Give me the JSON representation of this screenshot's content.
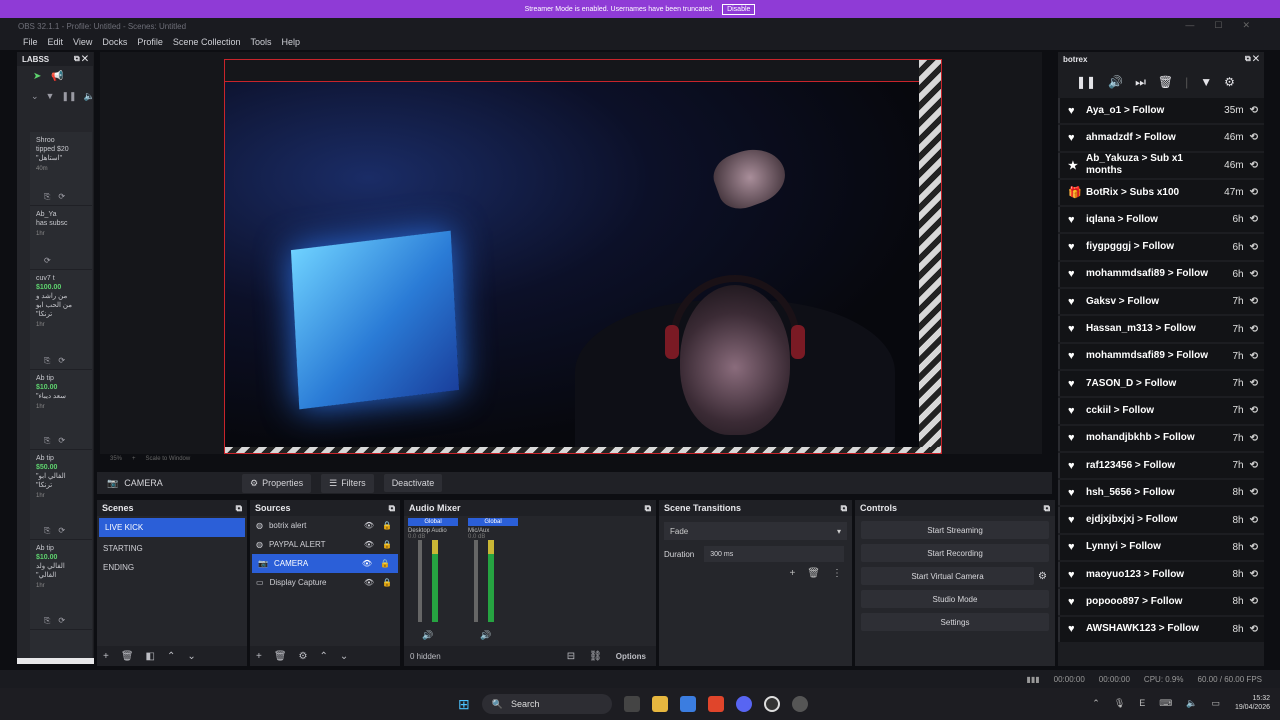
{
  "banner": {
    "text": "Streamer Mode is enabled. Usernames have been truncated.",
    "button": "Disable"
  },
  "window": {
    "title": "OBS 32.1.1 - Profile: Untitled - Scenes: Untitled"
  },
  "menu": [
    "File",
    "Edit",
    "View",
    "Docks",
    "Profile",
    "Scene Collection",
    "Tools",
    "Help"
  ],
  "labss": {
    "title": "LABSS",
    "items": [
      {
        "l1": "Shroo",
        "l2": "tipped $20",
        "l3": "\"استاهل\"",
        "time": "40m"
      },
      {
        "l1": "Ab_Ya",
        "l2": "has subsc",
        "l3": "",
        "time": "1hr"
      },
      {
        "l1": "cuv7 t",
        "amt": "$100.00",
        "l3": "من راشد و",
        "l4": "من الحب ابو",
        "l5": "\"ترنكا",
        "time": "1hr"
      },
      {
        "l1": "Ab tip",
        "amt": "$10.00",
        "l3": "\"سعد دیباء",
        "time": "1hr"
      },
      {
        "l1": "Ab tip",
        "amt": "$50.00",
        "l3": "\"الفالي ابو",
        "l4": "\"ترنكا",
        "time": "1hr"
      },
      {
        "l1": "Ab tip",
        "amt": "$10.00",
        "l3": "الفالي ولد",
        "l4": "\"الفالي",
        "time": "1hr"
      }
    ]
  },
  "preview": {
    "zoom": "35%",
    "scale": "Scale to Window"
  },
  "context": {
    "source": "CAMERA",
    "properties": "Properties",
    "filters": "Filters",
    "deactivate": "Deactivate"
  },
  "scenes": {
    "title": "Scenes",
    "items": [
      "LIVE KICK",
      "STARTING",
      "ENDING"
    ]
  },
  "sources": {
    "title": "Sources",
    "items": [
      "botrix alert",
      "PAYPAL ALERT",
      "CAMERA",
      "Display Capture"
    ]
  },
  "mixer": {
    "title": "Audio Mixer",
    "channels": [
      {
        "tag": "Global",
        "name": "Desktop Audio",
        "db": "0.0 dB"
      },
      {
        "tag": "Global",
        "name": "Mic/Aux",
        "db": "0.0 dB"
      }
    ],
    "hidden": "0 hidden",
    "options": "Options"
  },
  "transitions": {
    "title": "Scene Transitions",
    "type": "Fade",
    "duration_label": "Duration",
    "duration": "300 ms"
  },
  "controls": {
    "title": "Controls",
    "buttons": [
      "Start Streaming",
      "Start Recording",
      "Start Virtual Camera",
      "Studio Mode",
      "Settings"
    ]
  },
  "botrix": {
    "title": "botrex",
    "events": [
      {
        "icon": "heart",
        "text": "Aya_o1 > Follow",
        "time": "35m"
      },
      {
        "icon": "heart",
        "text": "ahmadzdf > Follow",
        "time": "46m"
      },
      {
        "icon": "star",
        "text": "Ab_Yakuza > Sub x1 months",
        "time": "46m"
      },
      {
        "icon": "gift",
        "text": "BotRix > Subs x100",
        "time": "47m"
      },
      {
        "icon": "heart",
        "text": "iqlana > Follow",
        "time": "6h"
      },
      {
        "icon": "heart",
        "text": "fiygpgggj > Follow",
        "time": "6h"
      },
      {
        "icon": "heart",
        "text": "mohammdsafi89 > Follow",
        "time": "6h"
      },
      {
        "icon": "heart",
        "text": "Gaksv > Follow",
        "time": "7h"
      },
      {
        "icon": "heart",
        "text": "Hassan_m313 > Follow",
        "time": "7h"
      },
      {
        "icon": "heart",
        "text": "mohammdsafi89 > Follow",
        "time": "7h"
      },
      {
        "icon": "heart",
        "text": "7ASON_D > Follow",
        "time": "7h"
      },
      {
        "icon": "heart",
        "text": "cckiil > Follow",
        "time": "7h"
      },
      {
        "icon": "heart",
        "text": "mohandjbkhb > Follow",
        "time": "7h"
      },
      {
        "icon": "heart",
        "text": "raf123456 > Follow",
        "time": "7h"
      },
      {
        "icon": "heart",
        "text": "hsh_5656 > Follow",
        "time": "8h"
      },
      {
        "icon": "heart",
        "text": "ejdjxjbxjxj > Follow",
        "time": "8h"
      },
      {
        "icon": "heart",
        "text": "Lynnyi > Follow",
        "time": "8h"
      },
      {
        "icon": "heart",
        "text": "maoyuo123 > Follow",
        "time": "8h"
      },
      {
        "icon": "heart",
        "text": "popooo897 > Follow",
        "time": "8h"
      },
      {
        "icon": "heart",
        "text": "AWSHAWK123 > Follow",
        "time": "8h"
      }
    ]
  },
  "status": {
    "stream_time": "00:00:00",
    "rec_time": "00:00:00",
    "cpu": "CPU: 0.9%",
    "fps": "60.00 / 60.00 FPS"
  },
  "taskbar": {
    "search": "Search",
    "time": "15:32",
    "date": "19/04/2026"
  },
  "colors": {
    "accent": "#2b5fd8",
    "banner": "#8f3bd6",
    "record_red": "#c8242b",
    "meter_green": "#26a341"
  }
}
